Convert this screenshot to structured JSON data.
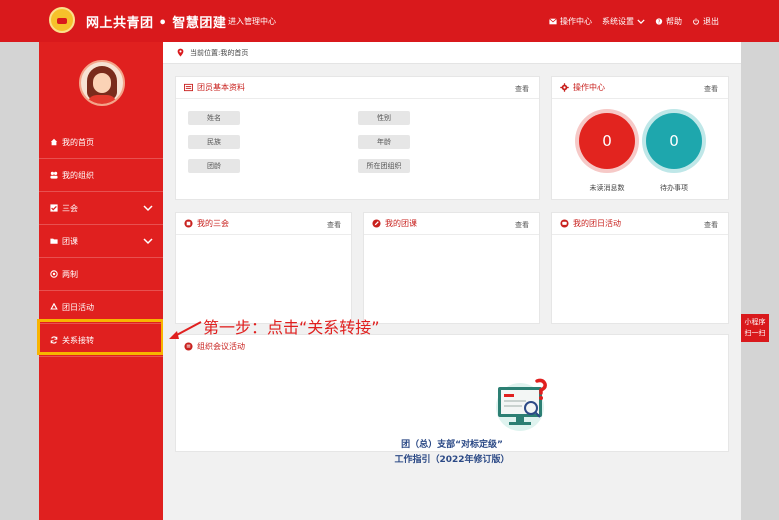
{
  "header": {
    "brand": "网上共青团 • 智慧团建",
    "enter_admin": "进入管理中心",
    "nav": [
      {
        "label": "操作中心",
        "icon": "mail-icon"
      },
      {
        "label": "系统设置",
        "icon": "chevron-down-icon"
      },
      {
        "label": "帮助",
        "icon": "help-icon"
      },
      {
        "label": "退出",
        "icon": "power-icon"
      }
    ]
  },
  "sidebar": {
    "items": [
      {
        "label": "我的首页",
        "icon": "home-icon"
      },
      {
        "label": "我的组织",
        "icon": "group-icon"
      },
      {
        "label": "三会",
        "icon": "checkbox-icon"
      },
      {
        "label": "团课",
        "icon": "folder-icon"
      },
      {
        "label": "两制",
        "icon": "target-icon"
      },
      {
        "label": "团日活动",
        "icon": "cycle-icon"
      },
      {
        "label": "关系接转",
        "icon": "refresh-icon"
      }
    ]
  },
  "location": {
    "text": "当前位置:我的首页"
  },
  "panels": {
    "basic_info": {
      "title": "团员基本资料",
      "view": "查看",
      "fields": [
        "姓名",
        "性别",
        "民族",
        "年龄",
        "团龄",
        "所在团组织"
      ]
    },
    "ops_center": {
      "title": "操作中心",
      "view": "查看",
      "unread_count": "0",
      "unread_label": "未读消息数",
      "todo_count": "0",
      "todo_label": "待办事项"
    },
    "my_meetings": {
      "title": "我的三会",
      "view": "查看"
    },
    "my_courses": {
      "title": "我的团课",
      "view": "查看"
    },
    "my_activities": {
      "title": "我的团日活动",
      "view": "查看"
    },
    "org_meeting": {
      "title": "组织会议活动",
      "guide_line1": "团（总）支部“对标定级”",
      "guide_line2": "工作指引（2022年修订版）"
    }
  },
  "annotation": {
    "text": "第一步：点击“关系转接”"
  },
  "mini_program": {
    "line1": "小程序",
    "line2": "扫一扫"
  },
  "colors": {
    "brand_red": "#d9191c",
    "sidebar_red": "#e0201f",
    "highlight": "#f8b400",
    "teal": "#1ea7ad",
    "guide_blue": "#2c4a86"
  }
}
